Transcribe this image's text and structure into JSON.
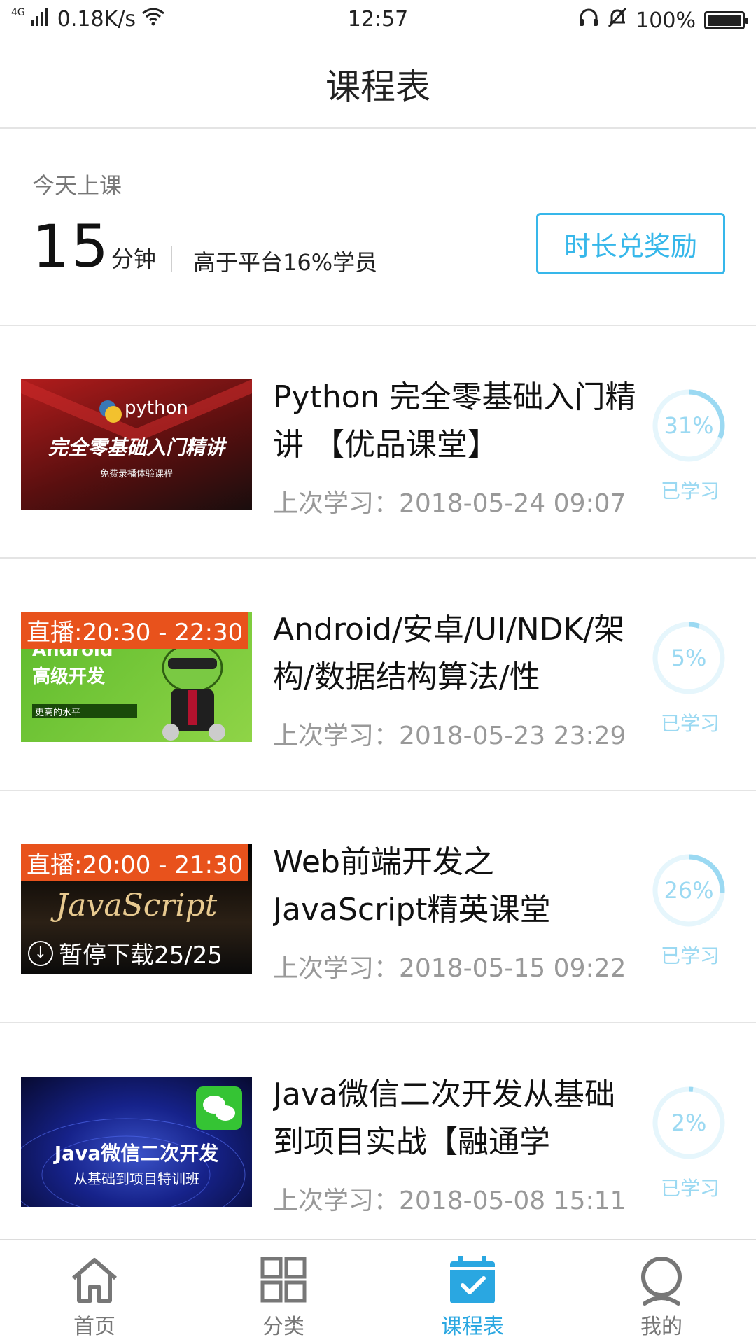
{
  "status_bar": {
    "network": "4G",
    "speed": "0.18K/s",
    "time": "12:57",
    "battery": "100%",
    "battery_level": 1.0
  },
  "header": {
    "title": "课程表"
  },
  "today": {
    "label": "今天上课",
    "minutes": "15",
    "minutes_unit": "分钟",
    "compare_text": "高于平台16%学员",
    "reward_button": "时长兑奖励"
  },
  "courses": [
    {
      "title": "Python 完全零基础入门精讲 【优品课堂】",
      "last_study": "上次学习：2018-05-24 09:07",
      "progress_label": "31%",
      "progress": 0.31,
      "learned_label": "已学习",
      "thumb": {
        "brand": "python",
        "headline": "完全零基础入门精讲",
        "sub": "免费录播体验课程",
        "colors": [
          "#8b1414",
          "#1a0d0d"
        ]
      }
    },
    {
      "title": "Android/安卓/UI/NDK/架构/数据结构算法/性",
      "last_study": "上次学习：2018-05-23 23:29",
      "progress_label": "5%",
      "progress": 0.05,
      "learned_label": "已学习",
      "live_badge": "直播:20:30 - 22:30",
      "thumb": {
        "brand": "Android",
        "headline": "高级开发",
        "sub": "更高的水平",
        "colors": [
          "#5dbb2c",
          "#8fd447"
        ]
      }
    },
    {
      "title": "Web前端开发之JavaScript精英课堂",
      "last_study": "上次学习：2018-05-15 09:22",
      "progress_label": "26%",
      "progress": 0.26,
      "learned_label": "已学习",
      "live_badge": "直播:20:00 - 21:30",
      "download_badge": "暂停下载25/25",
      "thumb": {
        "brand": "JavaScript",
        "colors": [
          "#000000",
          "#2b2015"
        ]
      }
    },
    {
      "title": "Java微信二次开发从基础到项目实战【融通学",
      "last_study": "上次学习：2018-05-08 15:11",
      "progress_label": "2%",
      "progress": 0.02,
      "learned_label": "已学习",
      "thumb": {
        "headline": "Java微信二次开发",
        "sub": "从基础到项目特训班",
        "colors": [
          "#1a2a8a",
          "#0b0f3a"
        ]
      }
    }
  ],
  "tabbar": {
    "items": [
      {
        "label": "首页",
        "icon": "home-icon"
      },
      {
        "label": "分类",
        "icon": "grid-icon"
      },
      {
        "label": "课程表",
        "icon": "calendar-check-icon",
        "active": true
      },
      {
        "label": "我的",
        "icon": "user-icon"
      }
    ]
  },
  "colors": {
    "accent": "#2aa7e1",
    "reward_border": "#36b7ea",
    "live_badge": "#e8521c",
    "progress_light": "#9bd9f2"
  }
}
